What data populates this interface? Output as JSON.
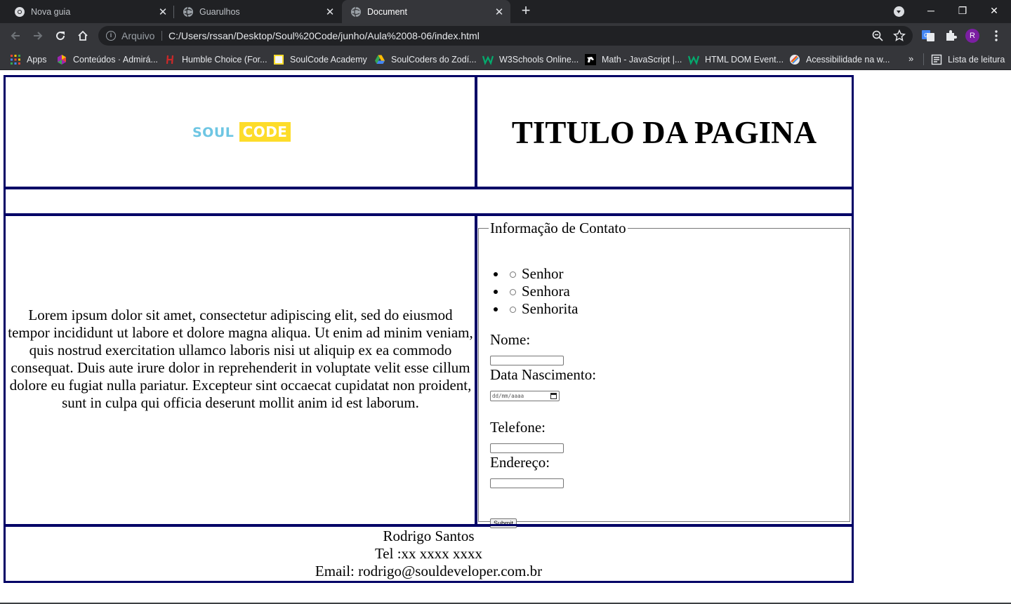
{
  "browser": {
    "tabs": [
      {
        "title": "Nova guia",
        "active": false,
        "icon": "chrome-icon"
      },
      {
        "title": "Guarulhos",
        "active": false,
        "icon": "globe-icon"
      },
      {
        "title": "Document",
        "active": true,
        "icon": "globe-icon"
      }
    ],
    "address": {
      "security_label": "Arquivo",
      "url": "C:/Users/rssan/Desktop/Soul%20Code/junho/Aula%2008-06/index.html"
    },
    "profile_initial": "R",
    "bookmarks": [
      {
        "label": "Apps",
        "icon": "apps-grid-icon"
      },
      {
        "label": "Conteúdos · Admirá...",
        "icon": "colorful-hex-icon"
      },
      {
        "label": "Humble Choice (For...",
        "icon": "humble-h-icon"
      },
      {
        "label": "SoulCode Academy",
        "icon": "soulcode-icon"
      },
      {
        "label": "SoulCoders do Zodí...",
        "icon": "google-drive-icon"
      },
      {
        "label": "W3Schools Online...",
        "icon": "w3schools-icon"
      },
      {
        "label": "Math - JavaScript |...",
        "icon": "mdn-icon"
      },
      {
        "label": "HTML DOM Event...",
        "icon": "w3schools-icon"
      },
      {
        "label": "Acessibilidade na w...",
        "icon": "rainbow-icon"
      }
    ],
    "reading_list_label": "Lista de leitura",
    "colors": {
      "tab_bg": "#202124",
      "toolbar_bg": "#35363a",
      "table_border": "#000066"
    }
  },
  "page": {
    "logo": {
      "soul": "SOUL",
      "code": "CODE"
    },
    "title": "TITULO DA PAGINA",
    "lorem": "Lorem ipsum dolor sit amet, consectetur adipiscing elit, sed do eiusmod tempor incididunt ut labore et dolore magna aliqua. Ut enim ad minim veniam, quis nostrud exercitation ullamco laboris nisi ut aliquip ex ea commodo consequat. Duis aute irure dolor in reprehenderit in voluptate velit esse cillum dolore eu fugiat nulla pariatur. Excepteur sint occaecat cupidatat non proident, sunt in culpa qui officia deserunt mollit anim id est laborum.",
    "form": {
      "legend": "Informação de Contato",
      "radio_options": [
        "Senhor",
        "Senhora",
        "Senhorita"
      ],
      "nome_label": "Nome:",
      "nascimento_label": "Data Nascimento:",
      "date_placeholder": "dd/mm/aaaa",
      "telefone_label": "Telefone:",
      "endereco_label": "Endereço:",
      "submit_label": "Submit"
    },
    "footer": {
      "name": "Rodrigo Santos",
      "tel": "Tel :xx xxxx xxxx",
      "email": "Email: rodrigo@souldeveloper.com.br"
    }
  }
}
